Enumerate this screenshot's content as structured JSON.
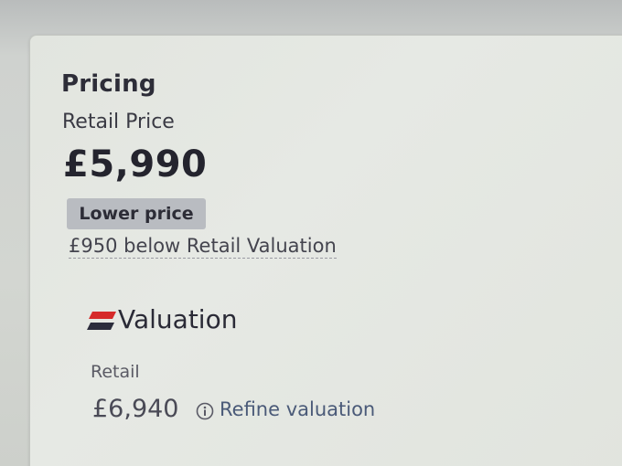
{
  "pricing": {
    "title": "Pricing",
    "retail_label": "Retail Price",
    "price": "£5,990",
    "badge": "Lower price",
    "comparison": "£950 below Retail Valuation"
  },
  "valuation": {
    "title": "Valuation",
    "retail_label": "Retail",
    "retail_value": "£6,940",
    "refine_link": "Refine valuation",
    "logo_colors": [
      "#d62a2a",
      "#2c2c3c"
    ]
  },
  "icons": {
    "info": "info-icon",
    "logo": "valuation-logo-icon"
  }
}
